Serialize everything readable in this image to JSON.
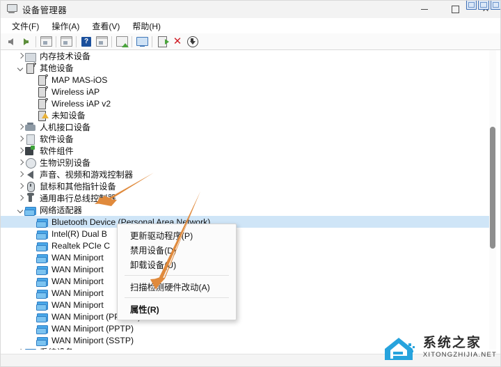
{
  "window": {
    "title": "设备管理器",
    "icon": "device-manager-icon",
    "minimize": "最小化",
    "maximize": "最大化",
    "close": "关闭"
  },
  "menubar": {
    "items": [
      {
        "label": "文件(F)",
        "name": "menu-file"
      },
      {
        "label": "操作(A)",
        "name": "menu-action"
      },
      {
        "label": "查看(V)",
        "name": "menu-view"
      },
      {
        "label": "帮助(H)",
        "name": "menu-help"
      }
    ]
  },
  "toolbar": {
    "buttons": [
      {
        "name": "back-button",
        "icon": "arrow-left-icon",
        "tip": "后退"
      },
      {
        "name": "forward-button",
        "icon": "arrow-right-icon",
        "tip": "前进"
      },
      {
        "name": "show-hide-console-tree-button",
        "icon": "console-tree-icon",
        "tip": "显示/隐藏控制台树"
      },
      {
        "name": "properties-button",
        "icon": "properties-window-icon",
        "tip": "属性"
      },
      {
        "name": "help-button",
        "icon": "help-icon",
        "tip": "帮助"
      },
      {
        "name": "view-button",
        "icon": "view-window-icon",
        "tip": "查看"
      },
      {
        "name": "scan-hardware-changes-button",
        "icon": "scan-hardware-icon",
        "tip": "扫描检测硬件改动"
      },
      {
        "name": "update-driver-button",
        "icon": "monitor-icon",
        "tip": "更新驱动程序"
      },
      {
        "name": "enable-device-button",
        "icon": "enable-device-icon",
        "tip": "启用设备"
      },
      {
        "name": "uninstall-device-button",
        "icon": "red-x-icon",
        "tip": "卸载设备"
      },
      {
        "name": "install-legacy-hardware-button",
        "icon": "download-arrow-icon",
        "tip": "添加过时硬件"
      }
    ]
  },
  "tree": {
    "rows": [
      {
        "label": "内存技术设备",
        "indent": 1,
        "state": "closed",
        "icon": "memory-device-icon",
        "name": "tree-item-memory-technology-devices"
      },
      {
        "label": "其他设备",
        "indent": 1,
        "state": "open",
        "icon": "unknown-device-icon",
        "name": "tree-item-other-devices"
      },
      {
        "label": "MAP MAS-iOS",
        "indent": 2,
        "state": "leaf",
        "icon": "unknown-device-icon",
        "name": "tree-item-map-mas-ios"
      },
      {
        "label": "Wireless iAP",
        "indent": 2,
        "state": "leaf",
        "icon": "unknown-device-icon",
        "name": "tree-item-wireless-iap"
      },
      {
        "label": "Wireless iAP v2",
        "indent": 2,
        "state": "leaf",
        "icon": "unknown-device-icon",
        "name": "tree-item-wireless-iap-v2"
      },
      {
        "label": "未知设备",
        "indent": 2,
        "state": "leaf",
        "icon": "warning-device-icon",
        "name": "tree-item-unknown-device"
      },
      {
        "label": "人机接口设备",
        "indent": 1,
        "state": "closed",
        "icon": "hid-device-icon",
        "name": "tree-item-hid"
      },
      {
        "label": "软件设备",
        "indent": 1,
        "state": "closed",
        "icon": "software-device-icon",
        "name": "tree-item-software-devices"
      },
      {
        "label": "软件组件",
        "indent": 1,
        "state": "closed",
        "icon": "software-component-icon",
        "name": "tree-item-software-components"
      },
      {
        "label": "生物识别设备",
        "indent": 1,
        "state": "closed",
        "icon": "biometric-icon",
        "name": "tree-item-biometric-devices"
      },
      {
        "label": "声音、视频和游戏控制器",
        "indent": 1,
        "state": "closed",
        "icon": "sound-icon",
        "name": "tree-item-sound-video-game-controllers"
      },
      {
        "label": "鼠标和其他指针设备",
        "indent": 1,
        "state": "closed",
        "icon": "mouse-icon",
        "name": "tree-item-mice-and-pointing-devices"
      },
      {
        "label": "通用串行总线控制器",
        "indent": 1,
        "state": "closed",
        "icon": "usb-icon",
        "name": "tree-item-usb-controllers"
      },
      {
        "label": "网络适配器",
        "indent": 1,
        "state": "open",
        "icon": "network-adapter-icon",
        "name": "tree-item-network-adapters"
      },
      {
        "label": "Bluetooth Device (Personal Area Network)",
        "indent": 2,
        "state": "leaf",
        "icon": "network-adapter-icon",
        "selected": true,
        "name": "tree-item-bluetooth-device-pan"
      },
      {
        "label": "Intel(R) Dual B",
        "indent": 2,
        "state": "leaf",
        "icon": "network-adapter-icon",
        "name": "tree-item-intel-dual-band"
      },
      {
        "label": "Realtek PCIe C",
        "indent": 2,
        "state": "leaf",
        "icon": "network-adapter-icon",
        "name": "tree-item-realtek-pcie"
      },
      {
        "label": "WAN Miniport",
        "indent": 2,
        "state": "leaf",
        "icon": "network-adapter-icon",
        "name": "tree-item-wan-miniport-1"
      },
      {
        "label": "WAN Miniport",
        "indent": 2,
        "state": "leaf",
        "icon": "network-adapter-icon",
        "name": "tree-item-wan-miniport-2"
      },
      {
        "label": "WAN Miniport",
        "indent": 2,
        "state": "leaf",
        "icon": "network-adapter-icon",
        "name": "tree-item-wan-miniport-3"
      },
      {
        "label": "WAN Miniport",
        "indent": 2,
        "state": "leaf",
        "icon": "network-adapter-icon",
        "name": "tree-item-wan-miniport-4"
      },
      {
        "label": "WAN Miniport",
        "indent": 2,
        "state": "leaf",
        "icon": "network-adapter-icon",
        "name": "tree-item-wan-miniport-5"
      },
      {
        "label": "WAN Miniport (PPPOE)",
        "indent": 2,
        "state": "leaf",
        "icon": "network-adapter-icon",
        "name": "tree-item-wan-miniport-pppoe"
      },
      {
        "label": "WAN Miniport (PPTP)",
        "indent": 2,
        "state": "leaf",
        "icon": "network-adapter-icon",
        "name": "tree-item-wan-miniport-pptp"
      },
      {
        "label": "WAN Miniport (SSTP)",
        "indent": 2,
        "state": "leaf",
        "icon": "network-adapter-icon",
        "name": "tree-item-wan-miniport-sstp"
      },
      {
        "label": "系统设备",
        "indent": 1,
        "state": "closed",
        "icon": "system-device-icon",
        "name": "tree-item-system-devices"
      }
    ]
  },
  "context_menu": {
    "items": [
      {
        "label": "更新驱动程序(P)",
        "name": "ctx-update-driver",
        "bold": false,
        "sep_after": false
      },
      {
        "label": "禁用设备(D)",
        "name": "ctx-disable-device",
        "bold": false,
        "sep_after": false
      },
      {
        "label": "卸载设备(U)",
        "name": "ctx-uninstall-device",
        "bold": false,
        "sep_after": true
      },
      {
        "label": "扫描检测硬件改动(A)",
        "name": "ctx-scan-hardware-changes",
        "bold": false,
        "sep_after": true
      },
      {
        "label": "属性(R)",
        "name": "ctx-properties",
        "bold": true,
        "sep_after": false
      }
    ]
  },
  "annotations": {
    "arrow_color": "#e08a3c",
    "arrows": [
      {
        "name": "annotation-arrow-network-adapters",
        "points_to": "网络适配器"
      },
      {
        "name": "annotation-arrow-scan-hardware",
        "points_to": "扫描检测硬件改动(A)"
      }
    ]
  },
  "watermark": {
    "cn": "系统之家",
    "en": "XITONGZHIJIA.NET"
  }
}
